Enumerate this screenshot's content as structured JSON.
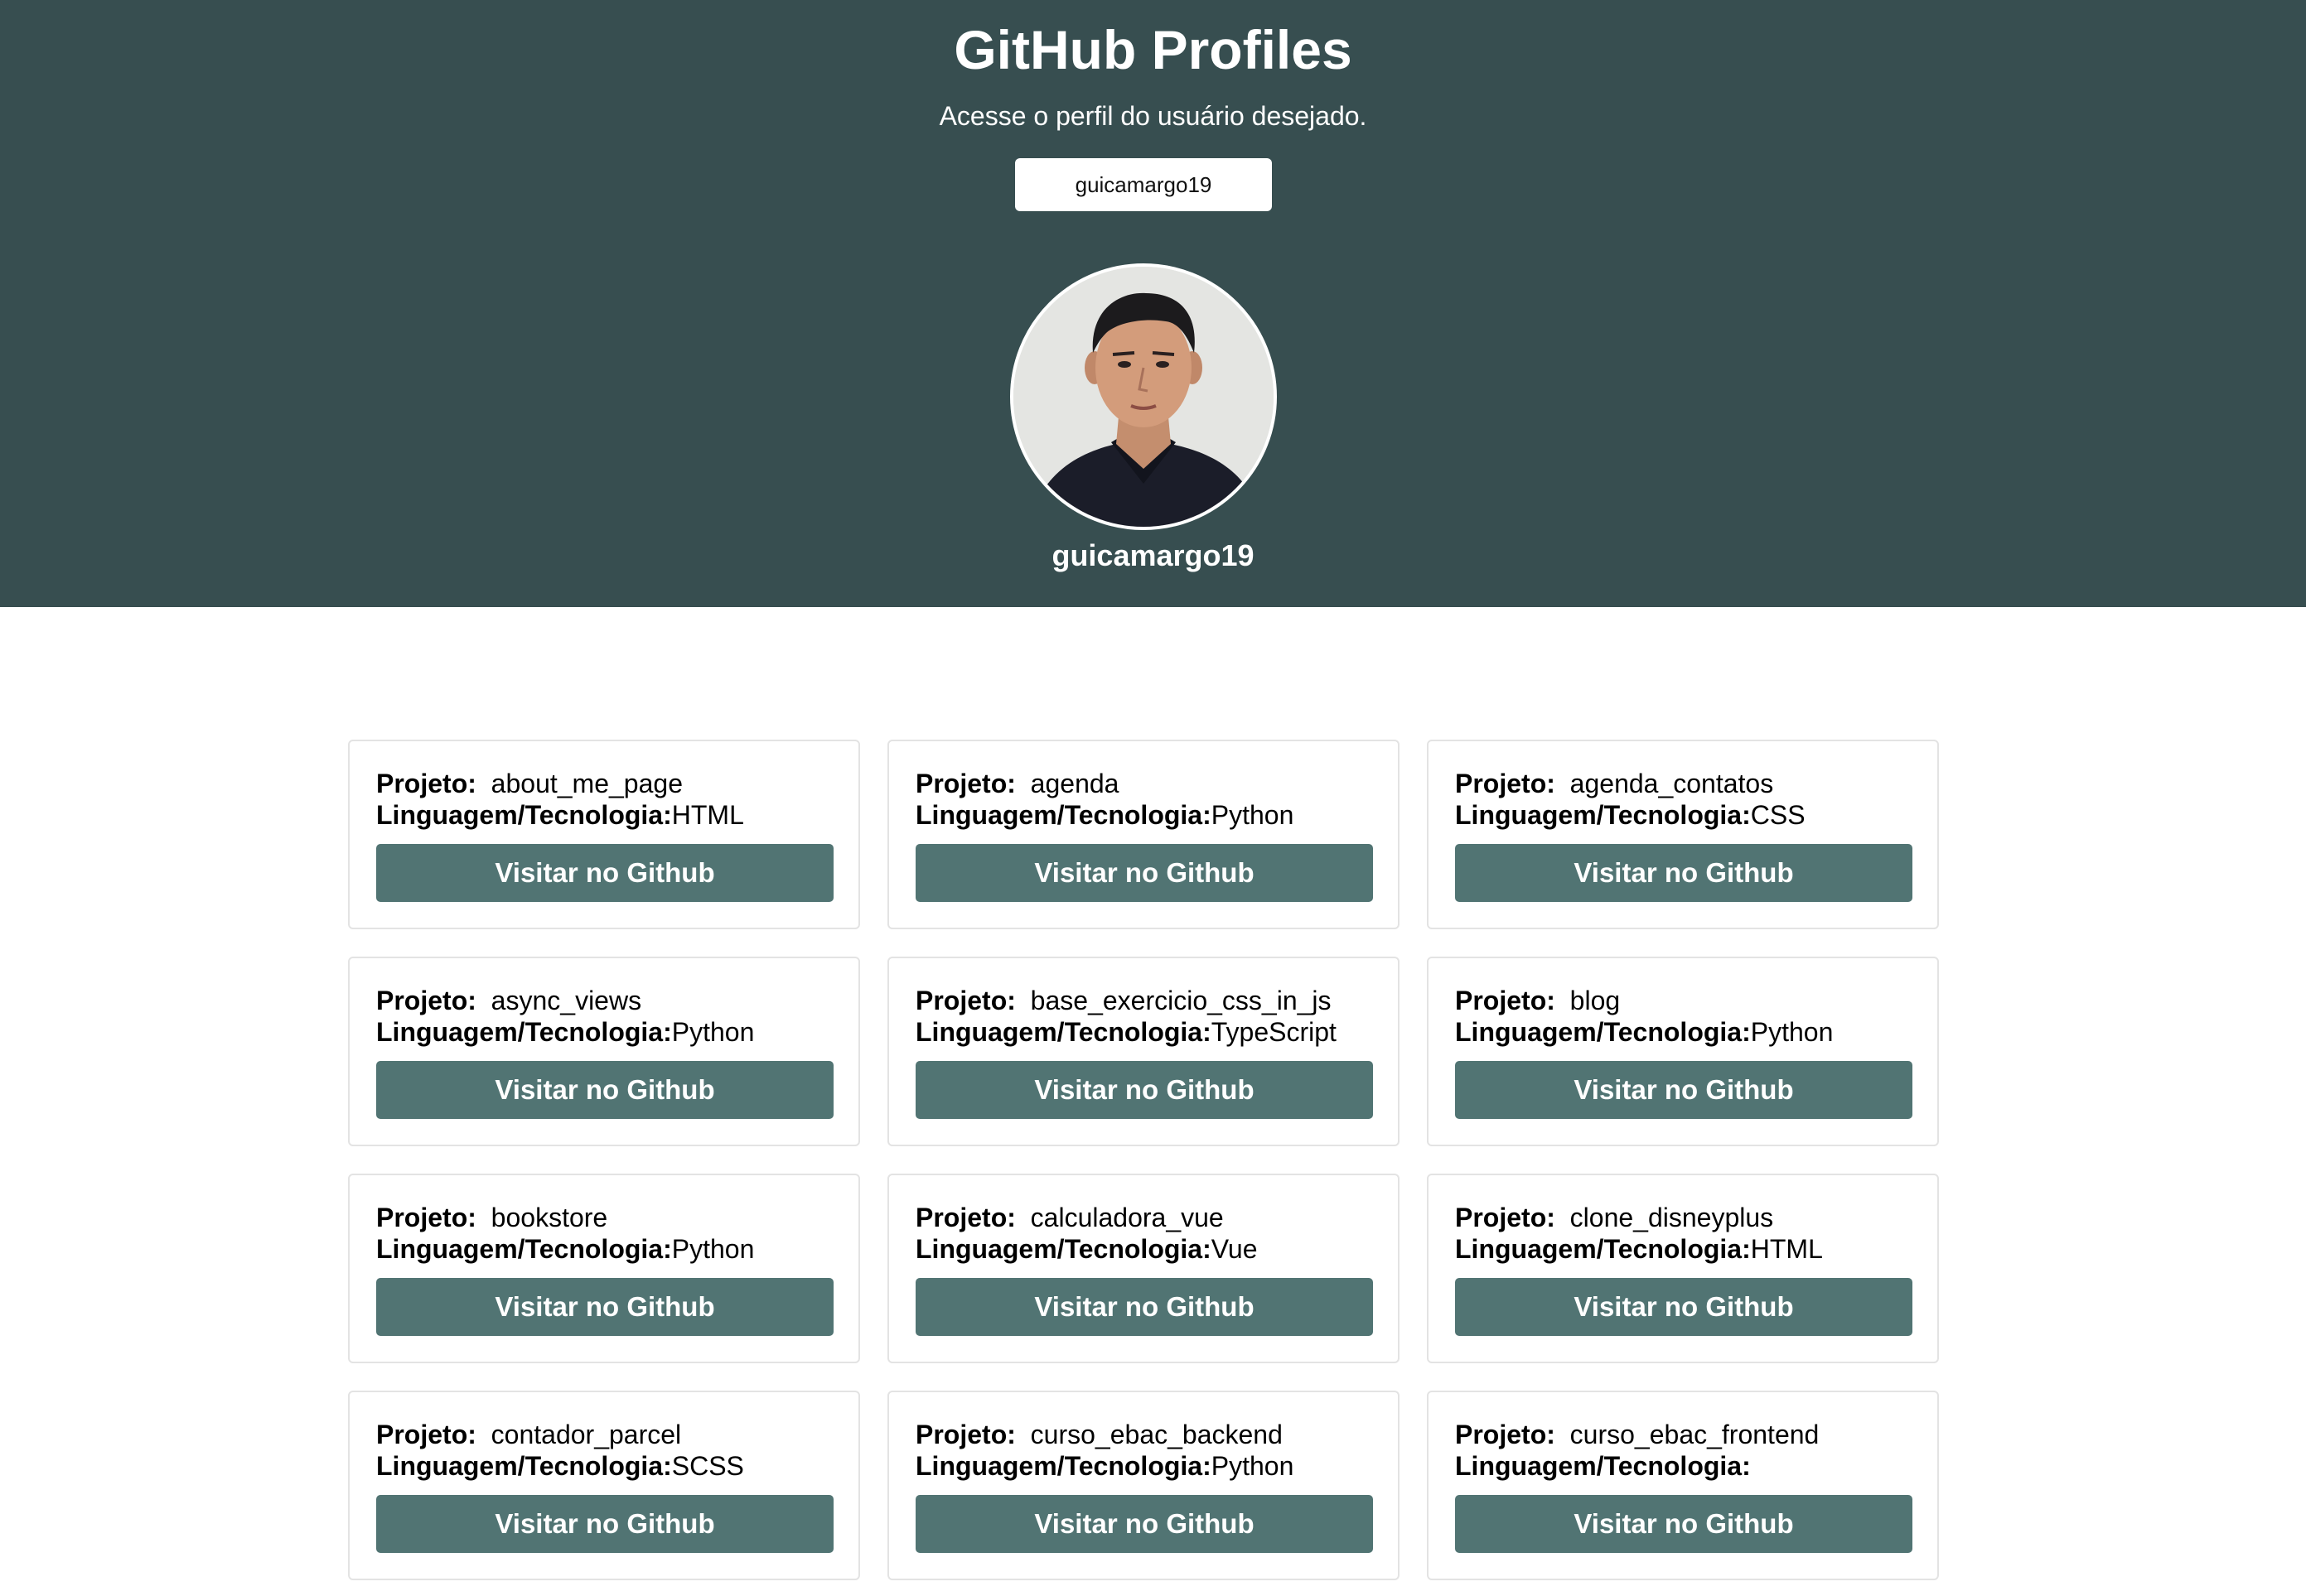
{
  "header": {
    "title": "GitHub Profiles",
    "subtitle": "Acesse o perfil do usuário desejado.",
    "search_value": "guicamargo19",
    "username": "guicamargo19",
    "background_color": "#374e50"
  },
  "labels": {
    "project": "Projeto:",
    "language": "Linguagem/Tecnologia:",
    "button": "Visitar no Github"
  },
  "button_color": "#517473",
  "repos": [
    {
      "name": "about_me_page",
      "language": "HTML"
    },
    {
      "name": "agenda",
      "language": "Python"
    },
    {
      "name": "agenda_contatos",
      "language": "CSS"
    },
    {
      "name": "async_views",
      "language": "Python"
    },
    {
      "name": "base_exercicio_css_in_js",
      "language": "TypeScript"
    },
    {
      "name": "blog",
      "language": "Python"
    },
    {
      "name": "bookstore",
      "language": "Python"
    },
    {
      "name": "calculadora_vue",
      "language": "Vue"
    },
    {
      "name": "clone_disneyplus",
      "language": "HTML"
    },
    {
      "name": "contador_parcel",
      "language": "SCSS"
    },
    {
      "name": "curso_ebac_backend",
      "language": "Python"
    },
    {
      "name": "curso_ebac_frontend",
      "language": ""
    }
  ]
}
